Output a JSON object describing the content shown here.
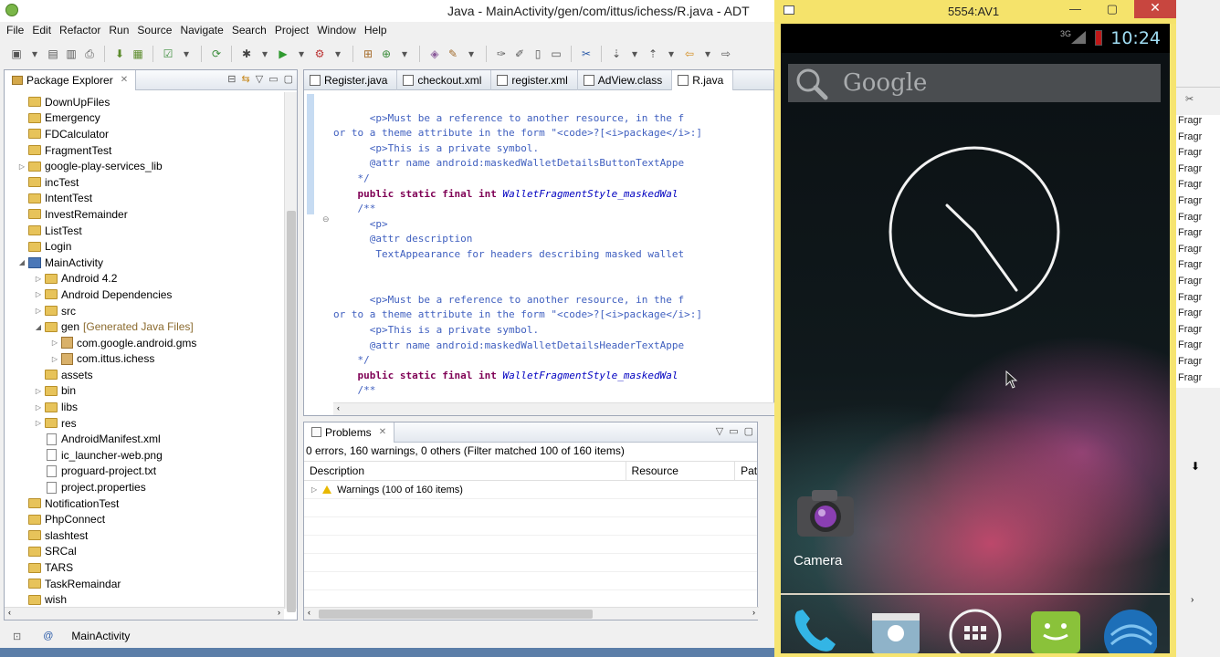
{
  "window": {
    "title": "Java - MainActivity/gen/com/ittus/ichess/R.java - ADT"
  },
  "menu": [
    "File",
    "Edit",
    "Refactor",
    "Run",
    "Source",
    "Navigate",
    "Search",
    "Project",
    "Window",
    "Help"
  ],
  "package_explorer": {
    "title": "Package Explorer",
    "items": [
      {
        "label": "DownUpFiles",
        "depth": 0,
        "kind": "folder",
        "arrow": ""
      },
      {
        "label": "Emergency",
        "depth": 0,
        "kind": "folder",
        "arrow": ""
      },
      {
        "label": "FDCalculator",
        "depth": 0,
        "kind": "folder",
        "arrow": ""
      },
      {
        "label": "FragmentTest",
        "depth": 0,
        "kind": "folder",
        "arrow": ""
      },
      {
        "label": "google-play-services_lib",
        "depth": 0,
        "kind": "folder",
        "arrow": "▷"
      },
      {
        "label": "incTest",
        "depth": 0,
        "kind": "folder",
        "arrow": ""
      },
      {
        "label": "IntentTest",
        "depth": 0,
        "kind": "folder",
        "arrow": ""
      },
      {
        "label": "InvestRemainder",
        "depth": 0,
        "kind": "folder",
        "arrow": ""
      },
      {
        "label": "ListTest",
        "depth": 0,
        "kind": "folder",
        "arrow": ""
      },
      {
        "label": "Login",
        "depth": 0,
        "kind": "folder",
        "arrow": ""
      },
      {
        "label": "MainActivity",
        "depth": 0,
        "kind": "proj",
        "arrow": "◢"
      },
      {
        "label": "Android 4.2",
        "depth": 1,
        "kind": "folder",
        "arrow": "▷"
      },
      {
        "label": "Android Dependencies",
        "depth": 1,
        "kind": "folder",
        "arrow": "▷"
      },
      {
        "label": "src",
        "depth": 1,
        "kind": "folder",
        "arrow": "▷"
      },
      {
        "label": "gen",
        "depth": 1,
        "kind": "folder",
        "arrow": "◢",
        "decor": "[Generated Java Files]"
      },
      {
        "label": "com.google.android.gms",
        "depth": 2,
        "kind": "pkg",
        "arrow": "▷"
      },
      {
        "label": "com.ittus.ichess",
        "depth": 2,
        "kind": "pkg",
        "arrow": "▷"
      },
      {
        "label": "assets",
        "depth": 1,
        "kind": "folder",
        "arrow": ""
      },
      {
        "label": "bin",
        "depth": 1,
        "kind": "folder",
        "arrow": "▷"
      },
      {
        "label": "libs",
        "depth": 1,
        "kind": "folder",
        "arrow": "▷"
      },
      {
        "label": "res",
        "depth": 1,
        "kind": "folder",
        "arrow": "▷"
      },
      {
        "label": "AndroidManifest.xml",
        "depth": 1,
        "kind": "file",
        "arrow": ""
      },
      {
        "label": "ic_launcher-web.png",
        "depth": 1,
        "kind": "file",
        "arrow": ""
      },
      {
        "label": "proguard-project.txt",
        "depth": 1,
        "kind": "file",
        "arrow": ""
      },
      {
        "label": "project.properties",
        "depth": 1,
        "kind": "file",
        "arrow": ""
      },
      {
        "label": "NotificationTest",
        "depth": 0,
        "kind": "folder",
        "arrow": ""
      },
      {
        "label": "PhpConnect",
        "depth": 0,
        "kind": "folder",
        "arrow": ""
      },
      {
        "label": "slashtest",
        "depth": 0,
        "kind": "folder",
        "arrow": ""
      },
      {
        "label": "SRCal",
        "depth": 0,
        "kind": "folder",
        "arrow": ""
      },
      {
        "label": "TARS",
        "depth": 0,
        "kind": "folder",
        "arrow": ""
      },
      {
        "label": "TaskRemaindar",
        "depth": 0,
        "kind": "folder",
        "arrow": ""
      },
      {
        "label": "wish",
        "depth": 0,
        "kind": "folder",
        "arrow": ""
      }
    ]
  },
  "editor": {
    "tabs": [
      "Register.java",
      "checkout.xml",
      "register.xml",
      "AdView.class",
      "R.java"
    ],
    "code_lines": [
      [],
      [
        {
          "t": "      <p>Must be a reference to another resource, in the f",
          "c": "c-comment"
        }
      ],
      [
        {
          "t": "or to a theme attribute in the form \"<code>?[<i>package</i>:]",
          "c": "c-comment"
        }
      ],
      [
        {
          "t": "      <p>This is a private symbol.",
          "c": "c-comment"
        }
      ],
      [
        {
          "t": "      @attr name android:maskedWalletDetailsButtonTextAppe",
          "c": "c-comment"
        }
      ],
      [
        {
          "t": "    */",
          "c": "c-comment"
        }
      ],
      [
        {
          "t": "    ",
          "c": "c-plain"
        },
        {
          "t": "public static final int ",
          "c": "c-kw"
        },
        {
          "t": "WalletFragmentStyle_maskedWal",
          "c": "c-field"
        }
      ],
      [
        {
          "t": "    /**",
          "c": "c-comment"
        }
      ],
      [
        {
          "t": "      <p>",
          "c": "c-comment"
        }
      ],
      [
        {
          "t": "      @attr description",
          "c": "c-comment"
        }
      ],
      [
        {
          "t": "       TextAppearance for headers describing masked wallet",
          "c": "c-comment"
        }
      ],
      [],
      [],
      [
        {
          "t": "      <p>Must be a reference to another resource, in the f",
          "c": "c-comment"
        }
      ],
      [
        {
          "t": "or to a theme attribute in the form \"<code>?[<i>package</i>:]",
          "c": "c-comment"
        }
      ],
      [
        {
          "t": "      <p>This is a private symbol.",
          "c": "c-comment"
        }
      ],
      [
        {
          "t": "      @attr name android:maskedWalletDetailsHeaderTextAppe",
          "c": "c-comment"
        }
      ],
      [
        {
          "t": "    */",
          "c": "c-comment"
        }
      ],
      [
        {
          "t": "    ",
          "c": "c-plain"
        },
        {
          "t": "public static final int ",
          "c": "c-kw"
        },
        {
          "t": "WalletFragmentStyle_maskedWal",
          "c": "c-field"
        }
      ],
      [
        {
          "t": "    /**",
          "c": "c-comment"
        }
      ]
    ]
  },
  "problems": {
    "title": "Problems",
    "summary": "0 errors, 160 warnings, 0 others (Filter matched 100 of 160 items)",
    "columns": [
      "Description",
      "Resource",
      "Path"
    ],
    "rows": [
      {
        "description": "Warnings (100 of 160 items)"
      }
    ]
  },
  "statusbar": {
    "text": "MainActivity"
  },
  "emulator": {
    "title": "5554:AV1",
    "status_time": "10:24",
    "network": "3G",
    "search_label": "Google",
    "camera_label": "Camera"
  },
  "right_panel": {
    "items": [
      "Fragr",
      "Fragr",
      "Fragr",
      "Fragr",
      "Fragr",
      "Fragr",
      "Fragr",
      "Fragr",
      "Fragr",
      "Fragr",
      "Fragr",
      "Fragr",
      "Fragr",
      "Fragr",
      "Fragr",
      "Fragr",
      "Fragr"
    ]
  }
}
